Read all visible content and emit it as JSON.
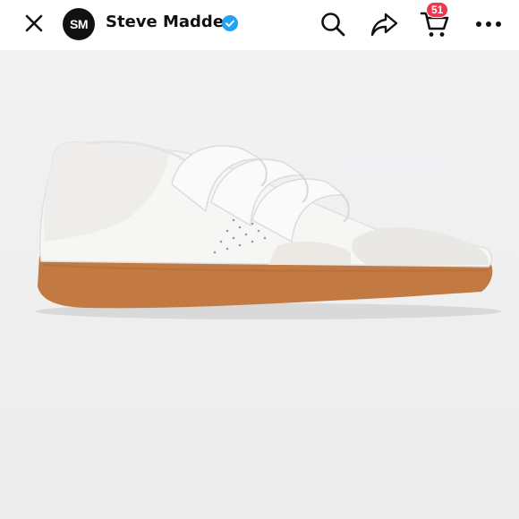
{
  "header": {
    "close_icon": "close-icon",
    "store": {
      "avatar_text": "SM",
      "name": "Steve Madden",
      "verified_icon": "verified-check-icon"
    },
    "actions": {
      "search_icon": "search-icon",
      "share_icon": "share-arrow-icon",
      "cart_icon": "shopping-cart-icon",
      "cart_count": "51",
      "more_icon": "more-dots-icon"
    }
  },
  "product": {
    "image_description_icon": "white-velcro-sneaker-gum-sole"
  },
  "colors": {
    "badge": "#f0374f",
    "verified": "#20a4f3",
    "background": "#efeff0",
    "sole": "#c27a42"
  }
}
